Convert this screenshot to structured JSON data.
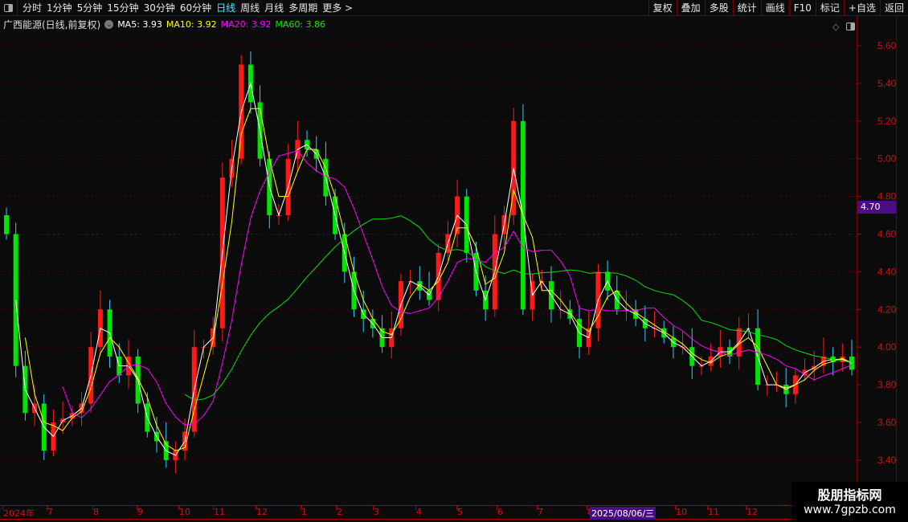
{
  "toolbar": {
    "periods": [
      "分时",
      "1分钟",
      "5分钟",
      "15分钟",
      "30分钟",
      "60分钟",
      "日线",
      "周线",
      "月线",
      "多周期",
      "更多 >"
    ],
    "active": "日线",
    "buttons": [
      "复权",
      "叠加",
      "多股",
      "统计",
      "画线",
      "F10",
      "标记",
      "+自选",
      "返回"
    ]
  },
  "legend": {
    "title": "广西能源(日线,前复权)",
    "ma5": "MA5: 3.93",
    "ma10": "MA10: 3.92",
    "ma20": "MA20: 3.92",
    "ma60": "MA60: 3.86"
  },
  "colors": {
    "up": "#ff1a1a",
    "down": "#00e600",
    "down_wick": "#33ccff",
    "ma5": "#ffffff",
    "ma10": "#ffff00",
    "ma20": "#ff00ff",
    "ma60": "#00e000",
    "axis": "#d01010",
    "highlight": "#4b0d86"
  },
  "yaxis": {
    "ticks": [
      "5.60",
      "5.40",
      "5.20",
      "5.00",
      "4.80",
      "4.60",
      "4.40",
      "4.20",
      "4.00",
      "3.80",
      "3.60",
      "3.40"
    ],
    "range": [
      3.3,
      5.7
    ]
  },
  "price_tag": "4.70",
  "xaxis": {
    "labels": [
      "2024年",
      "7",
      "8",
      "9",
      "10",
      "11",
      "12",
      "1",
      "2",
      "3",
      "4",
      "5",
      "6",
      "7",
      "8",
      "10",
      "11",
      "12"
    ],
    "cursor_date": "2025/08/06/三"
  },
  "chart_data": {
    "type": "candlestick",
    "closes": [
      4.6,
      3.9,
      3.65,
      3.7,
      3.45,
      3.6,
      3.62,
      3.65,
      3.7,
      4.0,
      4.2,
      3.95,
      3.85,
      3.95,
      3.7,
      3.55,
      3.5,
      3.4,
      3.45,
      3.55,
      4.0,
      4.0,
      4.1,
      4.9,
      5.0,
      5.5,
      5.3,
      5.0,
      4.7,
      4.7,
      5.0,
      5.1,
      5.05,
      5.0,
      4.8,
      4.6,
      4.4,
      4.2,
      4.15,
      4.1,
      4.0,
      4.1,
      4.35,
      4.35,
      4.3,
      4.25,
      4.5,
      4.6,
      4.8,
      4.5,
      4.3,
      4.2,
      4.6,
      4.7,
      5.2,
      4.2,
      4.35,
      4.35,
      4.2,
      4.2,
      4.15,
      4.0,
      4.1,
      4.4,
      4.3,
      4.2,
      4.2,
      4.15,
      4.1,
      4.1,
      4.05,
      4.0,
      4.0,
      3.9,
      3.9,
      3.95,
      4.0,
      3.95,
      4.1,
      4.1,
      3.8,
      3.8,
      3.8,
      3.75,
      3.85,
      3.88,
      3.9,
      3.95,
      3.92,
      3.95,
      3.88
    ],
    "ma_periods": [
      5,
      10,
      20,
      60
    ]
  },
  "watermark": {
    "name": "股朋指标网",
    "url": "www.7gpzb.com"
  }
}
